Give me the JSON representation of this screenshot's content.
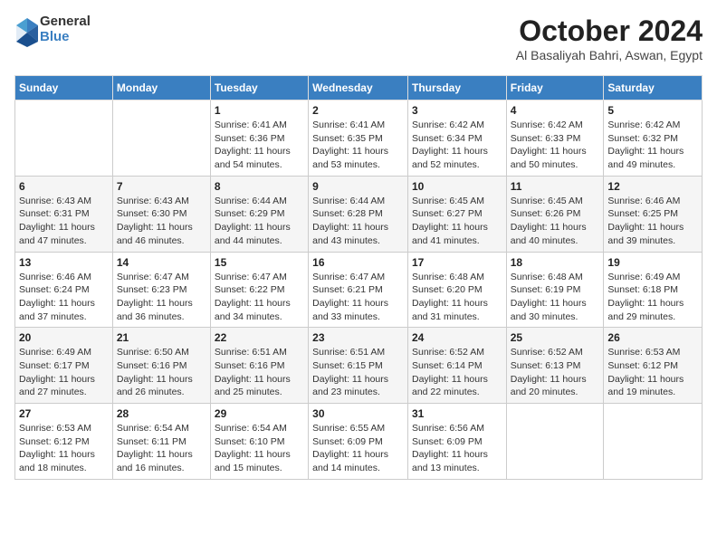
{
  "header": {
    "logo": {
      "general": "General",
      "blue": "Blue"
    },
    "title": "October 2024",
    "subtitle": "Al Basaliyah Bahri, Aswan, Egypt"
  },
  "weekdays": [
    "Sunday",
    "Monday",
    "Tuesday",
    "Wednesday",
    "Thursday",
    "Friday",
    "Saturday"
  ],
  "weeks": [
    [
      {
        "day": "",
        "info": ""
      },
      {
        "day": "",
        "info": ""
      },
      {
        "day": "1",
        "info": "Sunrise: 6:41 AM\nSunset: 6:36 PM\nDaylight: 11 hours\nand 54 minutes."
      },
      {
        "day": "2",
        "info": "Sunrise: 6:41 AM\nSunset: 6:35 PM\nDaylight: 11 hours\nand 53 minutes."
      },
      {
        "day": "3",
        "info": "Sunrise: 6:42 AM\nSunset: 6:34 PM\nDaylight: 11 hours\nand 52 minutes."
      },
      {
        "day": "4",
        "info": "Sunrise: 6:42 AM\nSunset: 6:33 PM\nDaylight: 11 hours\nand 50 minutes."
      },
      {
        "day": "5",
        "info": "Sunrise: 6:42 AM\nSunset: 6:32 PM\nDaylight: 11 hours\nand 49 minutes."
      }
    ],
    [
      {
        "day": "6",
        "info": "Sunrise: 6:43 AM\nSunset: 6:31 PM\nDaylight: 11 hours\nand 47 minutes."
      },
      {
        "day": "7",
        "info": "Sunrise: 6:43 AM\nSunset: 6:30 PM\nDaylight: 11 hours\nand 46 minutes."
      },
      {
        "day": "8",
        "info": "Sunrise: 6:44 AM\nSunset: 6:29 PM\nDaylight: 11 hours\nand 44 minutes."
      },
      {
        "day": "9",
        "info": "Sunrise: 6:44 AM\nSunset: 6:28 PM\nDaylight: 11 hours\nand 43 minutes."
      },
      {
        "day": "10",
        "info": "Sunrise: 6:45 AM\nSunset: 6:27 PM\nDaylight: 11 hours\nand 41 minutes."
      },
      {
        "day": "11",
        "info": "Sunrise: 6:45 AM\nSunset: 6:26 PM\nDaylight: 11 hours\nand 40 minutes."
      },
      {
        "day": "12",
        "info": "Sunrise: 6:46 AM\nSunset: 6:25 PM\nDaylight: 11 hours\nand 39 minutes."
      }
    ],
    [
      {
        "day": "13",
        "info": "Sunrise: 6:46 AM\nSunset: 6:24 PM\nDaylight: 11 hours\nand 37 minutes."
      },
      {
        "day": "14",
        "info": "Sunrise: 6:47 AM\nSunset: 6:23 PM\nDaylight: 11 hours\nand 36 minutes."
      },
      {
        "day": "15",
        "info": "Sunrise: 6:47 AM\nSunset: 6:22 PM\nDaylight: 11 hours\nand 34 minutes."
      },
      {
        "day": "16",
        "info": "Sunrise: 6:47 AM\nSunset: 6:21 PM\nDaylight: 11 hours\nand 33 minutes."
      },
      {
        "day": "17",
        "info": "Sunrise: 6:48 AM\nSunset: 6:20 PM\nDaylight: 11 hours\nand 31 minutes."
      },
      {
        "day": "18",
        "info": "Sunrise: 6:48 AM\nSunset: 6:19 PM\nDaylight: 11 hours\nand 30 minutes."
      },
      {
        "day": "19",
        "info": "Sunrise: 6:49 AM\nSunset: 6:18 PM\nDaylight: 11 hours\nand 29 minutes."
      }
    ],
    [
      {
        "day": "20",
        "info": "Sunrise: 6:49 AM\nSunset: 6:17 PM\nDaylight: 11 hours\nand 27 minutes."
      },
      {
        "day": "21",
        "info": "Sunrise: 6:50 AM\nSunset: 6:16 PM\nDaylight: 11 hours\nand 26 minutes."
      },
      {
        "day": "22",
        "info": "Sunrise: 6:51 AM\nSunset: 6:16 PM\nDaylight: 11 hours\nand 25 minutes."
      },
      {
        "day": "23",
        "info": "Sunrise: 6:51 AM\nSunset: 6:15 PM\nDaylight: 11 hours\nand 23 minutes."
      },
      {
        "day": "24",
        "info": "Sunrise: 6:52 AM\nSunset: 6:14 PM\nDaylight: 11 hours\nand 22 minutes."
      },
      {
        "day": "25",
        "info": "Sunrise: 6:52 AM\nSunset: 6:13 PM\nDaylight: 11 hours\nand 20 minutes."
      },
      {
        "day": "26",
        "info": "Sunrise: 6:53 AM\nSunset: 6:12 PM\nDaylight: 11 hours\nand 19 minutes."
      }
    ],
    [
      {
        "day": "27",
        "info": "Sunrise: 6:53 AM\nSunset: 6:12 PM\nDaylight: 11 hours\nand 18 minutes."
      },
      {
        "day": "28",
        "info": "Sunrise: 6:54 AM\nSunset: 6:11 PM\nDaylight: 11 hours\nand 16 minutes."
      },
      {
        "day": "29",
        "info": "Sunrise: 6:54 AM\nSunset: 6:10 PM\nDaylight: 11 hours\nand 15 minutes."
      },
      {
        "day": "30",
        "info": "Sunrise: 6:55 AM\nSunset: 6:09 PM\nDaylight: 11 hours\nand 14 minutes."
      },
      {
        "day": "31",
        "info": "Sunrise: 6:56 AM\nSunset: 6:09 PM\nDaylight: 11 hours\nand 13 minutes."
      },
      {
        "day": "",
        "info": ""
      },
      {
        "day": "",
        "info": ""
      }
    ]
  ]
}
